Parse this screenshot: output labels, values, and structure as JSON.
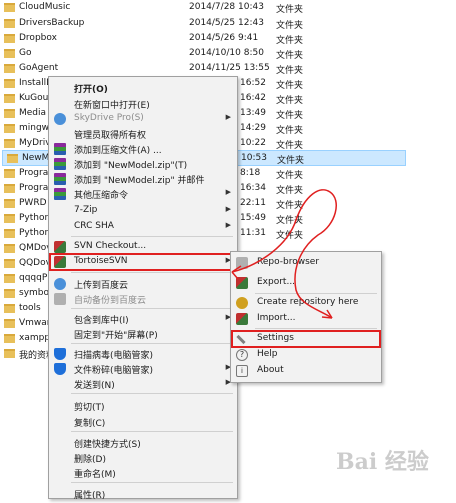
{
  "files": [
    {
      "name": "CloudMusic",
      "date": "2014/7/28 10:43",
      "type": "文件夹"
    },
    {
      "name": "DriversBackup",
      "date": "2014/5/25 12:43",
      "type": "文件夹"
    },
    {
      "name": "Dropbox",
      "date": "2014/5/26 9:41",
      "type": "文件夹"
    },
    {
      "name": "Go",
      "date": "2014/10/10 8:50",
      "type": "文件夹"
    },
    {
      "name": "GoAgent",
      "date": "2014/11/25 13:55",
      "type": "文件夹"
    },
    {
      "name": "InstallD",
      "date": "16:52",
      "type": "文件夹"
    },
    {
      "name": "KuGou",
      "date": "16:42",
      "type": "文件夹"
    },
    {
      "name": "Media",
      "date": "13:49",
      "type": "文件夹"
    },
    {
      "name": "mingw",
      "date": "14:29",
      "type": "文件夹"
    },
    {
      "name": "MyDriv",
      "date": "10:22",
      "type": "文件夹"
    },
    {
      "name": "NewMo",
      "date": "10:53",
      "type": "文件夹"
    },
    {
      "name": "Progra",
      "date": "8:18",
      "type": "文件夹"
    },
    {
      "name": "Progra",
      "date": "16:34",
      "type": "文件夹"
    },
    {
      "name": "PWRD",
      "date": "22:11",
      "type": "文件夹"
    },
    {
      "name": "Python",
      "date": "15:49",
      "type": "文件夹"
    },
    {
      "name": "Python",
      "date": "11:31",
      "type": "文件夹"
    },
    {
      "name": "QMDov",
      "date": "",
      "type": ""
    },
    {
      "name": "QQDov",
      "date": "",
      "type": ""
    },
    {
      "name": "qqqqP",
      "date": "",
      "type": ""
    },
    {
      "name": "symbol",
      "date": "",
      "type": ""
    },
    {
      "name": "tools",
      "date": "",
      "type": ""
    },
    {
      "name": "Vmwar",
      "date": "",
      "type": ""
    },
    {
      "name": "xampp",
      "date": "",
      "type": ""
    },
    {
      "name": "我的资料",
      "date": "",
      "type": ""
    }
  ],
  "context_menu": {
    "open": "打开(O)",
    "open_new_window": "在新窗口中打开(E)",
    "skydrive": "SkyDrive Pro(S)",
    "take_ownership": "管理员取得所有权",
    "add_archive": "添加到压缩文件(A) ...",
    "add_zip": "添加到 \"NewModel.zip\"(T)",
    "add_zip_mail": "添加到 \"NewModel.zip\" 并邮件",
    "other_compress": "其他压缩命令",
    "seven_zip": "7-Zip",
    "crc_sha": "CRC SHA",
    "svn_checkout": "SVN Checkout...",
    "tortoise": "TortoiseSVN",
    "baidu_upload": "上传到百度云",
    "baidu_backup": "自动备份到百度云",
    "include_library": "包含到库中(I)",
    "pin_start": "固定到\"开始\"屏幕(P)",
    "scan_virus": "扫描病毒(电脑管家)",
    "shred": "文件粉碎(电脑管家)",
    "send_to": "发送到(N)",
    "cut": "剪切(T)",
    "copy": "复制(C)",
    "create_shortcut": "创建快捷方式(S)",
    "delete": "删除(D)",
    "rename": "重命名(M)",
    "properties": "属性(R)"
  },
  "svn_submenu": {
    "repo_browser": "Repo-browser",
    "export": "Export...",
    "create_repo": "Create repository here",
    "import": "Import...",
    "settings": "Settings",
    "help": "Help",
    "about": "About"
  },
  "watermark": "Bai 经验",
  "colors": {
    "highlight": "#e02020",
    "selection": "#cce8ff",
    "folder": "#e8c05a"
  }
}
